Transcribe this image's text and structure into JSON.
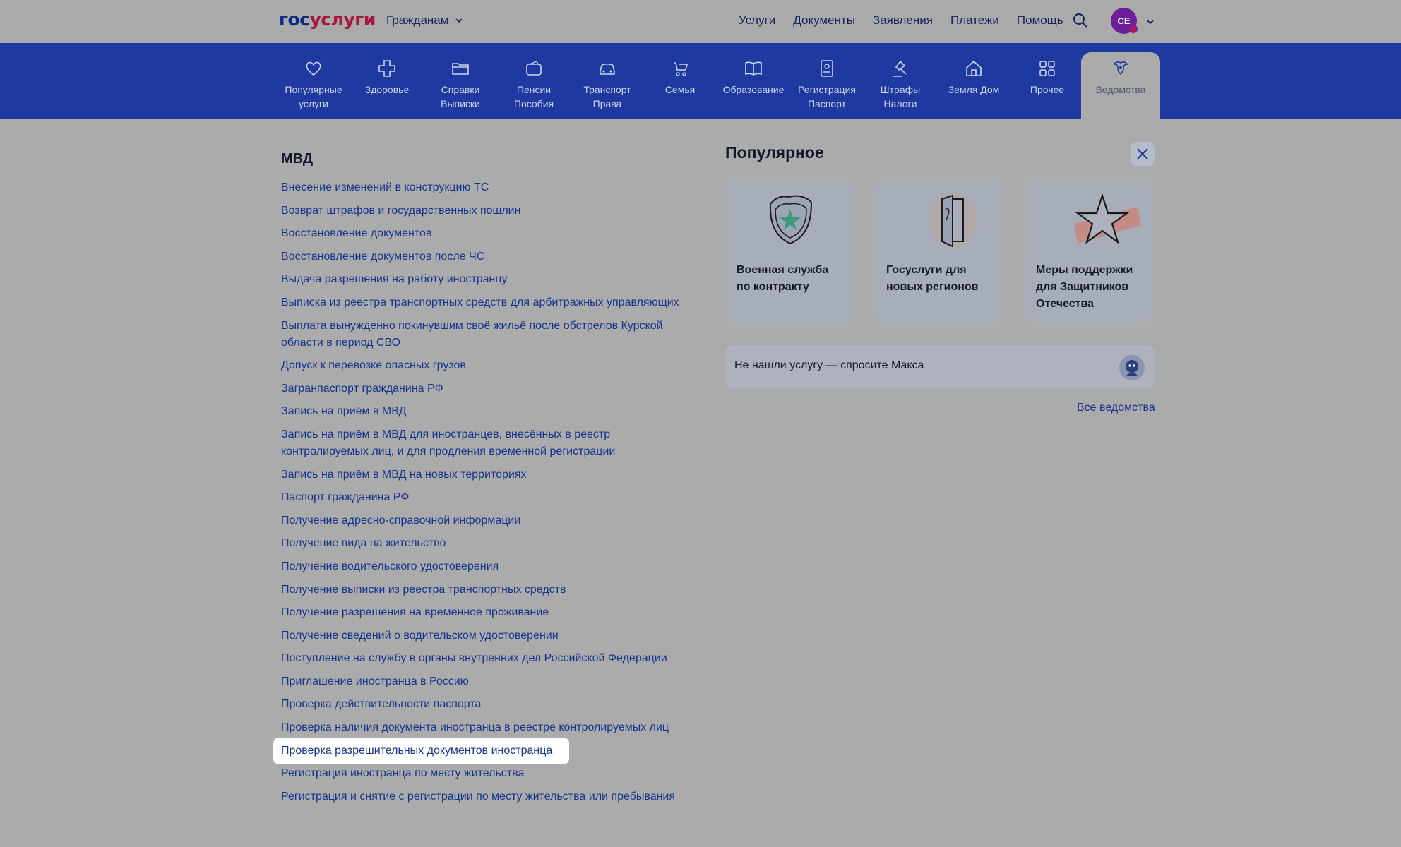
{
  "header": {
    "logo_part1": "гос",
    "logo_part2": "услуги",
    "citizens_label": "Гражданам",
    "nav": [
      "Услуги",
      "Документы",
      "Заявления",
      "Платежи",
      "Помощь"
    ],
    "avatar_initials": "СЕ"
  },
  "categories": [
    {
      "line1": "Популярные",
      "line2": "услуги",
      "icon": "heart-icon"
    },
    {
      "line1": "Здоровье",
      "line2": "",
      "icon": "cross-icon"
    },
    {
      "line1": "Справки",
      "line2": "Выписки",
      "icon": "folder-icon"
    },
    {
      "line1": "Пенсии",
      "line2": "Пособия",
      "icon": "wallet-icon"
    },
    {
      "line1": "Транспорт",
      "line2": "Права",
      "icon": "car-icon"
    },
    {
      "line1": "Семья",
      "line2": "",
      "icon": "stroller-icon"
    },
    {
      "line1": "Образование",
      "line2": "",
      "icon": "book-icon"
    },
    {
      "line1": "Регистрация",
      "line2": "Паспорт",
      "icon": "id-card-icon"
    },
    {
      "line1": "Штрафы",
      "line2": "Налоги",
      "icon": "gavel-icon"
    },
    {
      "line1": "Земля Дом",
      "line2": "",
      "icon": "house-icon"
    },
    {
      "line1": "Прочее",
      "line2": "",
      "icon": "grid-icon"
    },
    {
      "line1": "Ведомства",
      "line2": "",
      "icon": "emblem-icon"
    }
  ],
  "section": {
    "title": "МВД",
    "items": [
      "Внесение изменений в конструкцию ТС",
      "Возврат штрафов и государственных пошлин",
      "Восстановление документов",
      "Восстановление документов после ЧС",
      "Выдача разрешения на работу иностранцу",
      "Выписка из реестра транспортных средств для арбитражных управляющих",
      "Выплата вынужденно покинувшим своё жильё после обстрелов Курской области в период СВО",
      "Допуск к перевозке опасных грузов",
      "Загранпаспорт гражданина РФ",
      "Запись на приём в МВД",
      "Запись на приём в МВД для иностранцев, внесённых в реестр контролируемых лиц, и для продления временной регистрации",
      "Запись на приём в МВД на новых территориях",
      "Паспорт гражданина РФ",
      "Получение адресно-справочной информации",
      "Получение вида на жительство",
      "Получение водительского удостоверения",
      "Получение выписки из реестра транспортных средств",
      "Получение разрешения на временное проживание",
      "Получение сведений о водительском удостоверении",
      "Поступление на службу в органы внутренних дел Российской Федерации",
      "Приглашение иностранца в Россию",
      "Проверка действительности паспорта",
      "Проверка наличия документа иностранца в реестре контролируемых лиц",
      "Проверка разрешительных документов иностранца",
      "Регистрация иностранца по месту жительства",
      "Регистрация и снятие с регистрации по месту жительства или пребывания"
    ]
  },
  "popular": {
    "title": "Популярное",
    "cards": [
      {
        "text": "Военная служба по контракту",
        "icon": "shield-star-icon"
      },
      {
        "text": "Госуслуги для новых регионов",
        "icon": "door-icon"
      },
      {
        "text": "Меры поддержки для Защитников Отечества",
        "icon": "star-icon"
      }
    ],
    "ask": "Не нашли услугу — спросите Макса",
    "all_link": "Все ведомства"
  }
}
